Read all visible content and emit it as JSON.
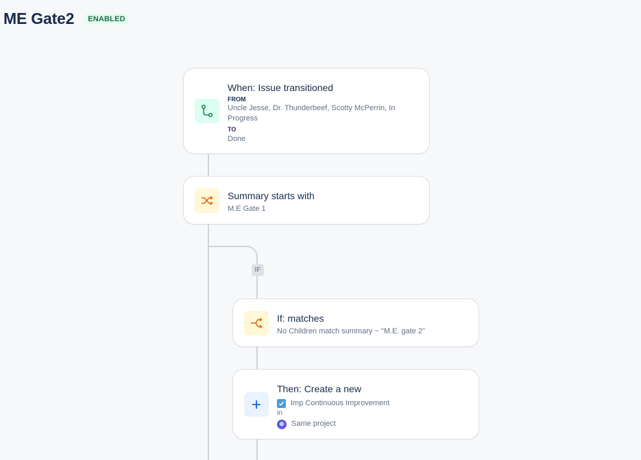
{
  "header": {
    "title": "ME Gate2",
    "status_badge": "ENABLED"
  },
  "trigger": {
    "title": "When: Issue transitioned",
    "from_label": "FROM",
    "from_value": "Uncle Jesse, Dr. Thunderbeef, Scotty McPerrin, In Progress",
    "to_label": "TO",
    "to_value": "Done",
    "icon": "transition-icon"
  },
  "condition": {
    "title": "Summary starts with",
    "value": "M.E Gate 1",
    "icon": "shuffle-icon"
  },
  "branch": {
    "tag": "IF"
  },
  "if_condition": {
    "title": "If: matches",
    "value": "No Children match summary ~ \"M.E. gate 2\"",
    "icon": "branch-condition-icon"
  },
  "action": {
    "title": "Then: Create a new",
    "issue_type": "Imp Continuous Improvement",
    "in_label": "in",
    "project": "Same project",
    "icon": "plus-icon"
  },
  "colors": {
    "background": "#f7f8f9",
    "badge_bg": "#e3fcef",
    "badge_text": "#216e4e",
    "green_icon": "#1f845a",
    "orange_icon": "#e56910",
    "blue_icon": "#0c66e4",
    "connector": "#cfd4db"
  }
}
